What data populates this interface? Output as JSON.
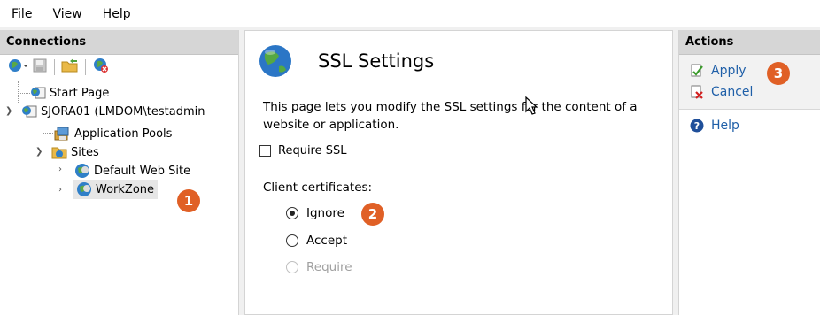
{
  "menu": {
    "items": [
      "File",
      "View",
      "Help"
    ]
  },
  "connections": {
    "header": "Connections",
    "tree": {
      "start_page": "Start Page",
      "server": "SJORA01 (LMDOM\\testadmin",
      "app_pools": "Application Pools",
      "sites": "Sites",
      "default_site": "Default Web Site",
      "workzone": "WorkZone"
    }
  },
  "main": {
    "title": "SSL Settings",
    "description": "This page lets you modify the SSL settings for the content of a website or application.",
    "require_ssl_label": "Require SSL",
    "require_ssl_checked": false,
    "client_certs_label": "Client certificates:",
    "client_cert_options": [
      {
        "label": "Ignore",
        "selected": true,
        "enabled": true
      },
      {
        "label": "Accept",
        "selected": false,
        "enabled": true
      },
      {
        "label": "Require",
        "selected": false,
        "enabled": false
      }
    ]
  },
  "actions": {
    "header": "Actions",
    "apply": "Apply",
    "cancel": "Cancel",
    "help": "Help"
  },
  "badges": {
    "one": "1",
    "two": "2",
    "three": "3"
  },
  "colors": {
    "badge": "#e06026",
    "link": "#1f5fa8",
    "header_bg": "#d6d6d6"
  }
}
